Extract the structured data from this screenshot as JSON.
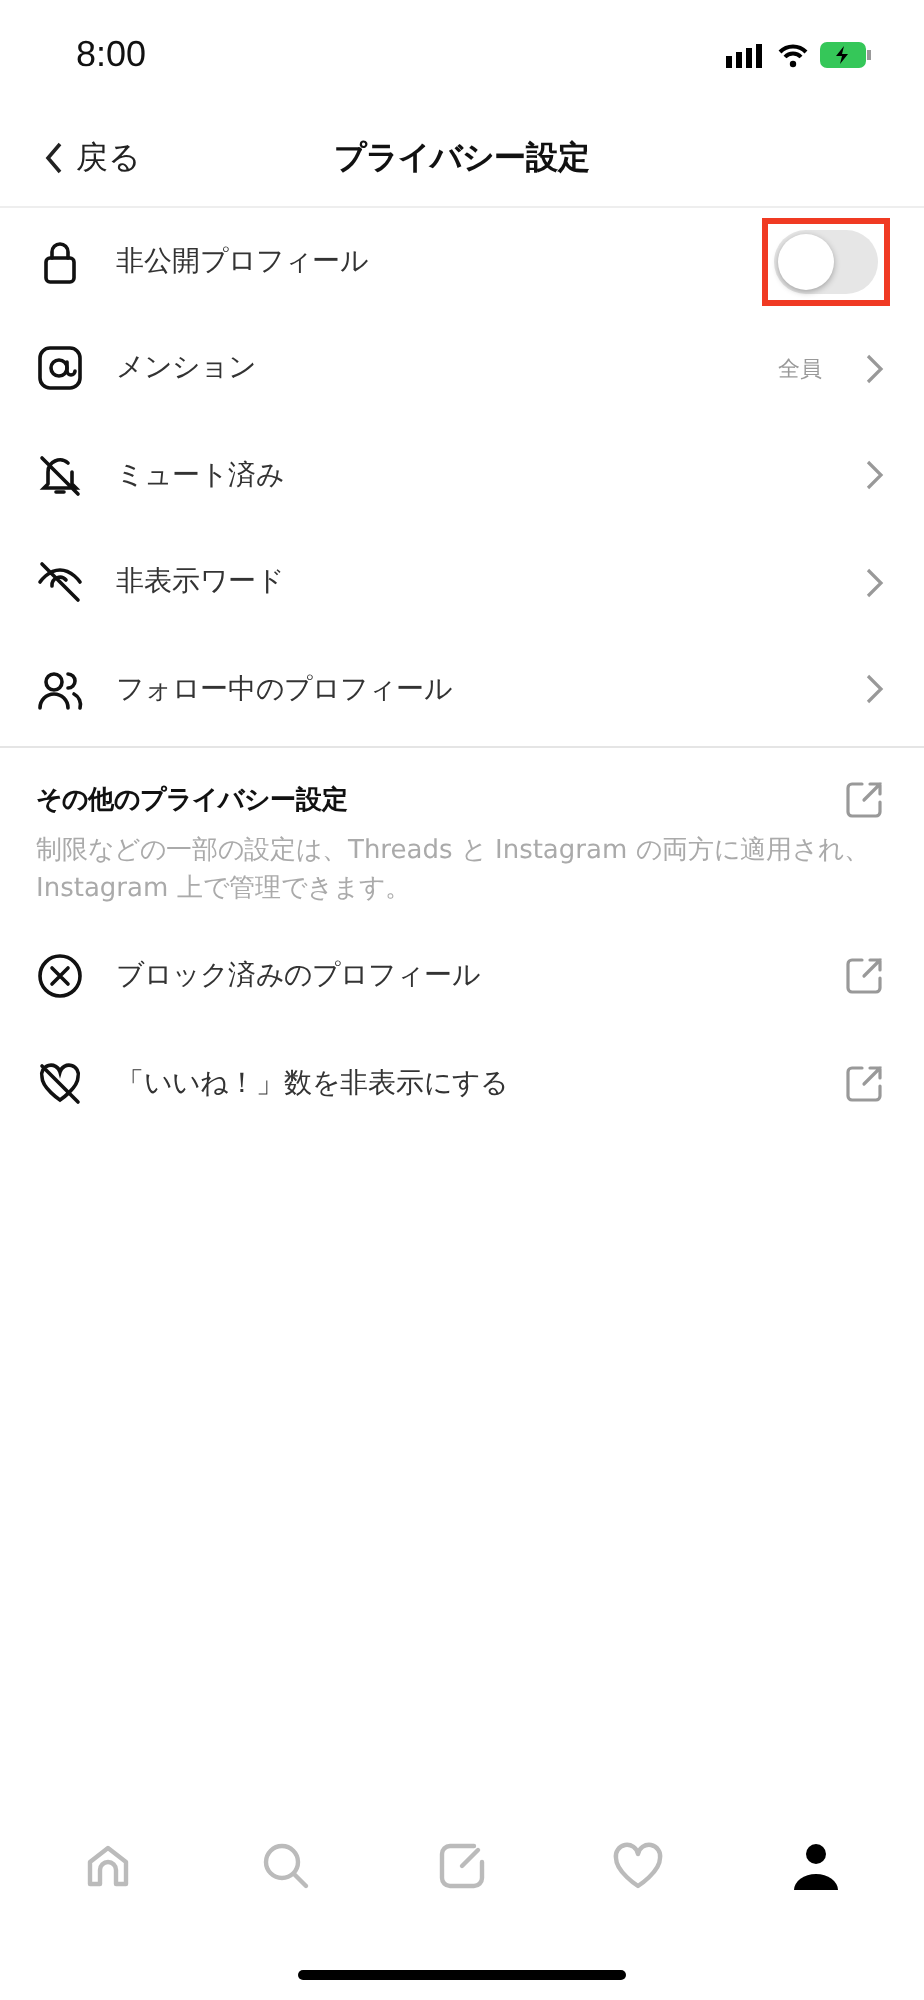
{
  "status_bar": {
    "time": "8:00"
  },
  "header": {
    "back": "戻る",
    "title": "プライバシー設定"
  },
  "items": [
    {
      "label": "非公開プロフィール",
      "kind": "toggle",
      "on": false,
      "highlighted": true
    },
    {
      "label": "メンション",
      "kind": "chevron",
      "value": "全員"
    },
    {
      "label": "ミュート済み",
      "kind": "chevron"
    },
    {
      "label": "非表示ワード",
      "kind": "chevron"
    },
    {
      "label": "フォロー中のプロフィール",
      "kind": "chevron"
    }
  ],
  "other_section": {
    "title": "その他のプライバシー設定",
    "description": "制限などの一部の設定は、Threads と Instagram の両方に適用され、Instagram 上で管理できます。",
    "items": [
      {
        "label": "ブロック済みのプロフィール"
      },
      {
        "label": "「いいね！」数を非表示にする"
      }
    ]
  },
  "nav": [
    {
      "selected": false
    },
    {
      "selected": false
    },
    {
      "selected": false
    },
    {
      "selected": false
    },
    {
      "selected": true
    }
  ]
}
